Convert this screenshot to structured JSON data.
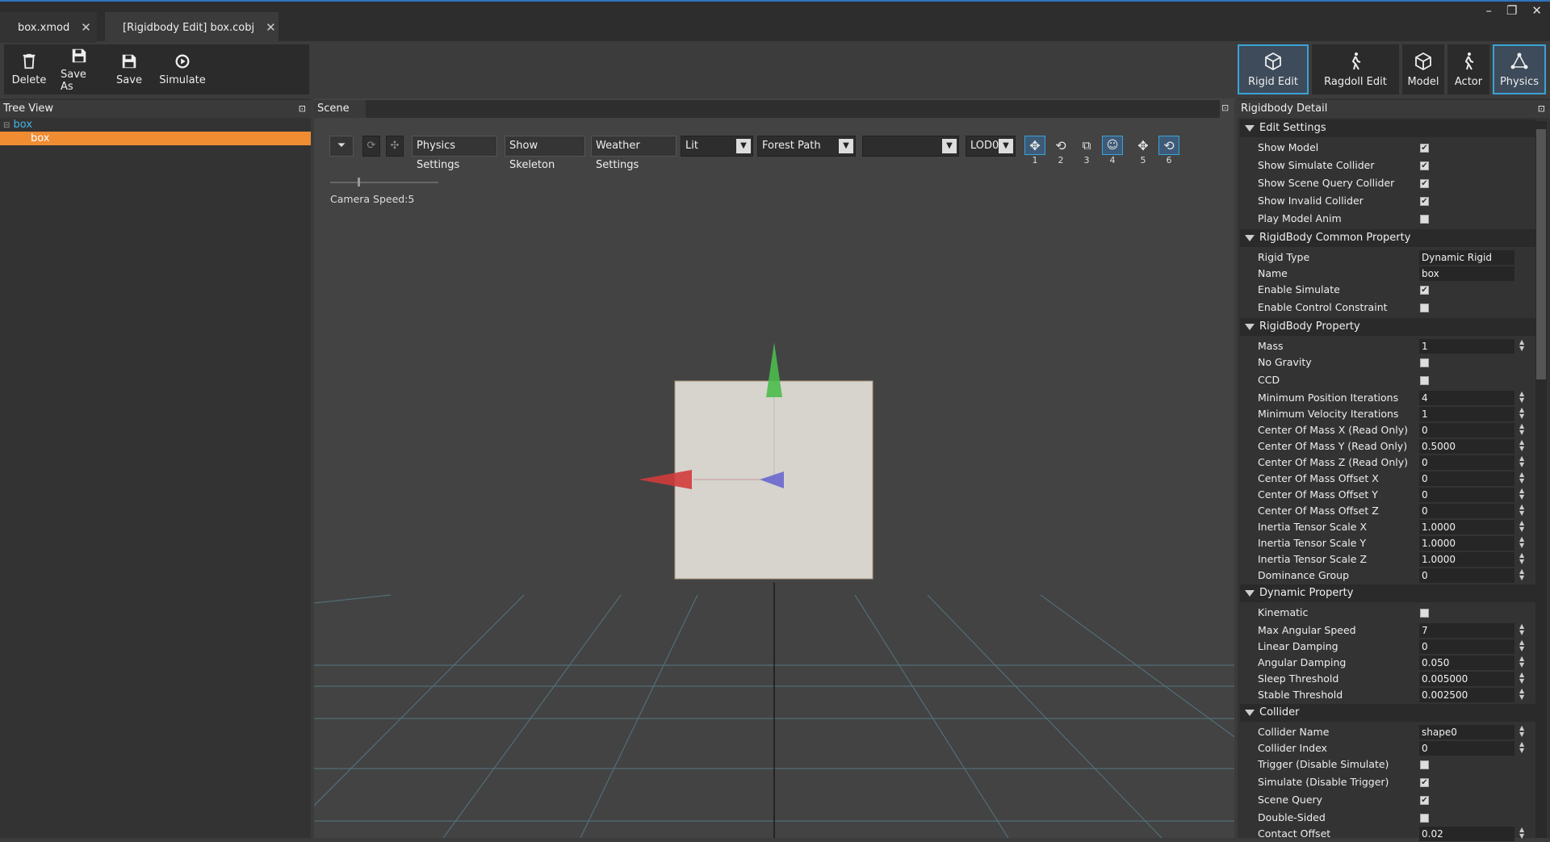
{
  "tabs": [
    {
      "label": "box.xmod"
    },
    {
      "label": "[Rigidbody Edit]  box.cobj"
    }
  ],
  "window_controls": [
    "–",
    "❐",
    "✕"
  ],
  "toolbar": {
    "delete": "Delete",
    "save_as": "Save As",
    "save": "Save",
    "simulate": "Simulate"
  },
  "right_toolbar": {
    "rigid_edit": "Rigid Edit",
    "ragdoll_edit": "Ragdoll Edit",
    "model": "Model",
    "actor": "Actor",
    "physics": "Physics"
  },
  "tree_view": {
    "title": "Tree View",
    "root": "box",
    "child": "box"
  },
  "scene": {
    "title": "Scene",
    "physics_settings": "Physics Settings",
    "show_skeleton": "Show Skeleton",
    "weather_settings": "Weather Settings",
    "shading": "Lit",
    "environment": "Forest Path",
    "empty_select": "",
    "lod": "LOD0",
    "camera_speed": "Camera Speed:5",
    "gizmo_numbers": [
      "1",
      "2",
      "3",
      "4",
      "5",
      "6"
    ]
  },
  "detail": {
    "title": "Rigidbody Detail",
    "sections": {
      "edit_settings": "Edit Settings",
      "common": "RigidBody Common Property",
      "property": "RigidBody Property",
      "dynamic": "Dynamic Property",
      "collider": "Collider"
    },
    "edit_settings": [
      {
        "label": "Show Model",
        "checked": "✔"
      },
      {
        "label": "Show Simulate Collider",
        "checked": "✔"
      },
      {
        "label": "Show Scene Query Collider",
        "checked": "✔"
      },
      {
        "label": "Show Invalid Collider",
        "checked": "✔"
      },
      {
        "label": "Play Model Anim",
        "checked": ""
      }
    ],
    "common": {
      "rigid_type_label": "Rigid Type",
      "rigid_type": "Dynamic Rigid",
      "name_label": "Name",
      "name": "box",
      "enable_simulate_label": "Enable Simulate",
      "enable_simulate": "✔",
      "enable_control_label": "Enable Control Constraint",
      "enable_control": ""
    },
    "property": [
      {
        "label": "Mass",
        "value": "1"
      },
      {
        "label": "No Gravity",
        "check": ""
      },
      {
        "label": "CCD",
        "check": ""
      },
      {
        "label": "Minimum Position Iterations",
        "value": "4"
      },
      {
        "label": "Minimum Velocity Iterations",
        "value": "1"
      },
      {
        "label": "Center Of Mass X (Read Only)",
        "value": "0"
      },
      {
        "label": "Center Of Mass Y (Read Only)",
        "value": "0.5000"
      },
      {
        "label": "Center Of Mass Z (Read Only)",
        "value": "0"
      },
      {
        "label": "Center Of Mass Offset X",
        "value": "0"
      },
      {
        "label": "Center Of Mass Offset Y",
        "value": "0"
      },
      {
        "label": "Center Of Mass Offset Z",
        "value": "0"
      },
      {
        "label": "Inertia Tensor Scale X",
        "value": "1.0000"
      },
      {
        "label": "Inertia Tensor Scale Y",
        "value": "1.0000"
      },
      {
        "label": "Inertia Tensor Scale Z",
        "value": "1.0000"
      },
      {
        "label": "Dominance Group",
        "value": "0"
      }
    ],
    "dynamic": [
      {
        "label": "Kinematic",
        "check": ""
      },
      {
        "label": "Max Angular Speed",
        "value": "7"
      },
      {
        "label": "Linear Damping",
        "value": "0"
      },
      {
        "label": "Angular Damping",
        "value": "0.050"
      },
      {
        "label": "Sleep Threshold",
        "value": "0.005000"
      },
      {
        "label": "Stable Threshold",
        "value": "0.002500"
      }
    ],
    "collider": [
      {
        "label": "Collider Name",
        "value": "shape0"
      },
      {
        "label": "Collider Index",
        "value": "0"
      },
      {
        "label": "Trigger (Disable Simulate)",
        "check": ""
      },
      {
        "label": "Simulate (Disable Trigger)",
        "check": "✔"
      },
      {
        "label": "Scene Query",
        "check": "✔"
      },
      {
        "label": "Double-Sided",
        "check": ""
      },
      {
        "label": "Contact Offset",
        "value": "0.02"
      }
    ]
  }
}
